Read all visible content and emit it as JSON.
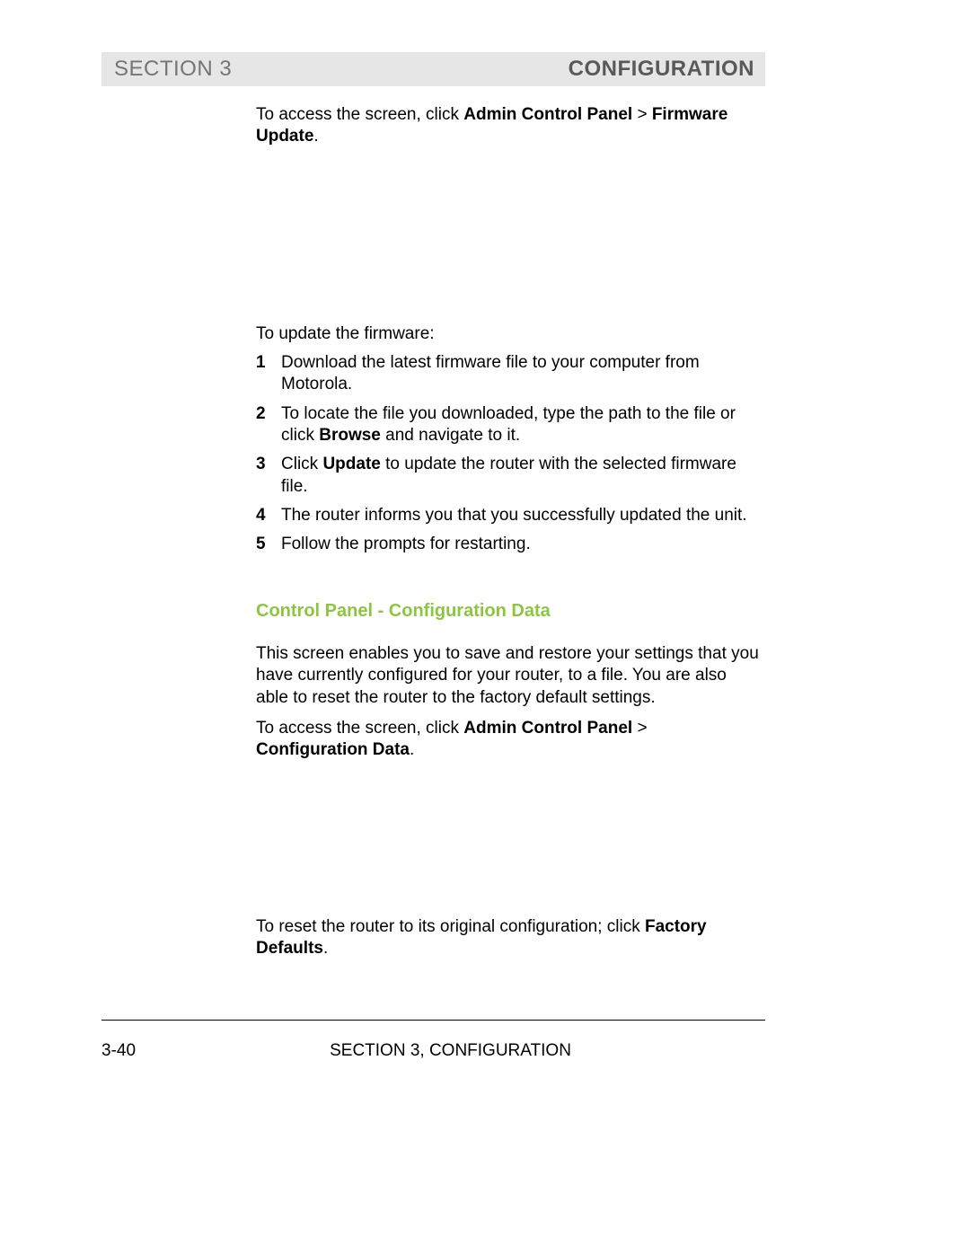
{
  "header": {
    "left": "SECTION 3",
    "right": "CONFIGURATION"
  },
  "intro": {
    "p1_a": "To access the screen, click ",
    "p1_b": "Admin Control Panel",
    "p1_c": " > ",
    "p1_d": "Firmware Update",
    "p1_e": "."
  },
  "update_intro": "To update the firmware:",
  "steps": {
    "n1": "1",
    "t1": "Download the latest firmware file to your computer from Motorola.",
    "n2": "2",
    "t2_a": "To locate the file you downloaded, type the path to the file or click ",
    "t2_b": "Browse",
    "t2_c": " and navigate to it.",
    "n3": "3",
    "t3_a": "Click ",
    "t3_b": "Update",
    "t3_c": " to update the router with the selected firmware file.",
    "n4": "4",
    "t4": "The router informs you that you successfully updated the unit.",
    "n5": "5",
    "t5": "Follow the prompts for restarting."
  },
  "section2": {
    "heading": "Control Panel - Configuration Data",
    "p1": "This screen enables you to save and restore your settings that you have currently configured for your router, to a file. You are also able to reset the router to the factory default settings.",
    "p2_a": "To access the screen, click ",
    "p2_b": "Admin Control Panel",
    "p2_c": " > ",
    "p2_d": "Configuration Data",
    "p2_e": ".",
    "p3_a": "To reset the router to its original configuration; click ",
    "p3_b": "Factory Defaults",
    "p3_c": "."
  },
  "footer": {
    "page": "3-40",
    "center": "SECTION 3, CONFIGURATION"
  }
}
